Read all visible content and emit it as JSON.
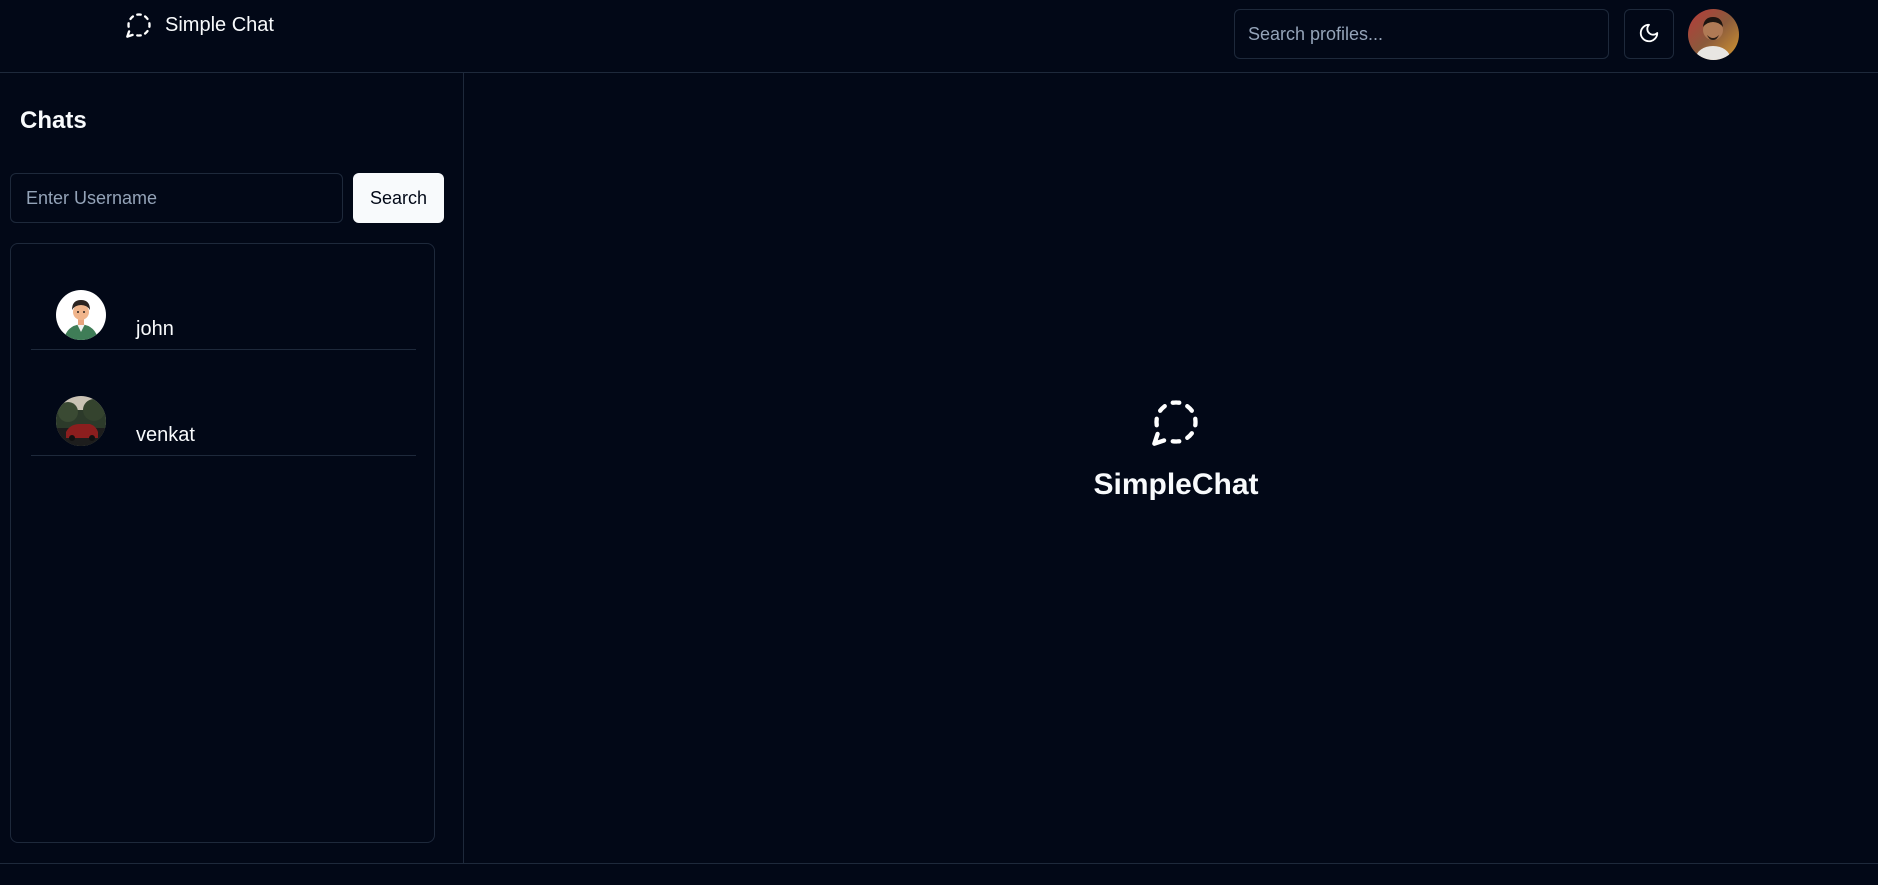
{
  "app": {
    "brand_name": "Simple Chat",
    "icon": "dashed-message-circle-icon"
  },
  "header": {
    "search_placeholder": "Search profiles...",
    "theme_toggle_icon": "moon-icon",
    "user_avatar": "user-avatar-photo"
  },
  "sidebar": {
    "title": "Chats",
    "username_placeholder": "Enter Username",
    "search_label": "Search",
    "chats": [
      {
        "name": "john",
        "avatar": "cartoon-man-avatar"
      },
      {
        "name": "venkat",
        "avatar": "photo-avatar"
      }
    ]
  },
  "main": {
    "empty_title": "SimpleChat",
    "empty_icon": "dashed-message-circle-icon"
  },
  "colors": {
    "background": "#020817",
    "border": "#1e293b",
    "text": "#f8fafc",
    "muted": "#94a3b8"
  }
}
